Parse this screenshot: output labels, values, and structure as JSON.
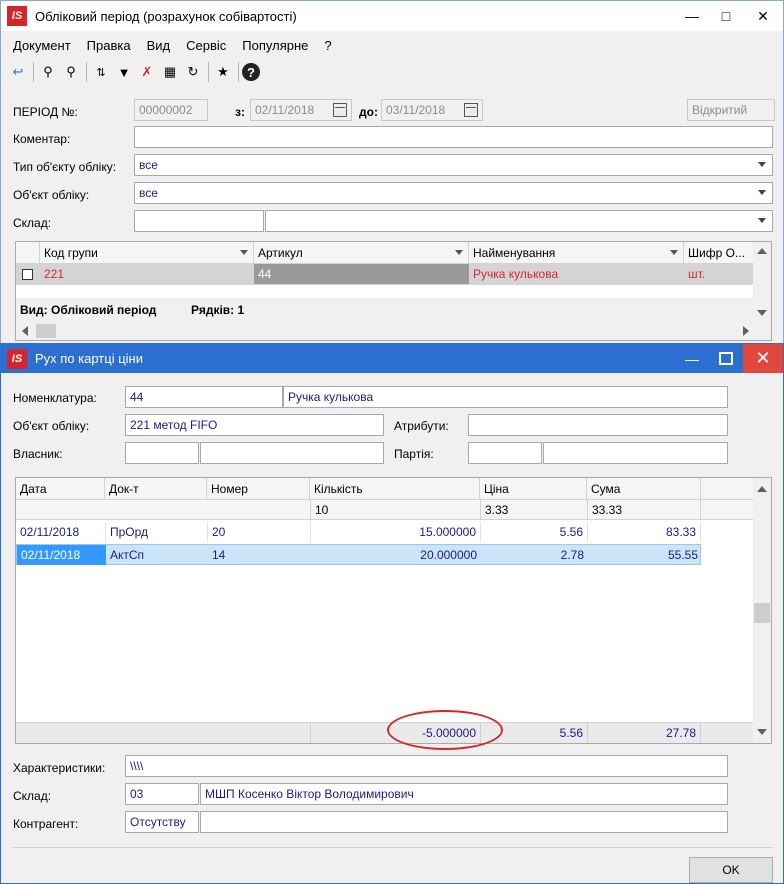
{
  "main_window": {
    "title": "Обліковий період (розрахунок собівартості)",
    "menu": [
      "Документ",
      "Правка",
      "Вид",
      "Сервіс",
      "Популярне",
      "?"
    ],
    "period_label": "ПЕРІОД №:",
    "period_value": "00000002",
    "from_label": "з:",
    "from_value": "02/11/2018",
    "to_label": "до:",
    "to_value": "03/11/2018",
    "status_value": "Відкритий",
    "comment_label": "Коментар:",
    "comment_value": "",
    "object_type_label": "Тип об'єкту обліку:",
    "object_type_value": "все",
    "object_label": "Об'єкт обліку:",
    "object_value": "все",
    "warehouse_label": "Склад:",
    "grid": {
      "columns": [
        "Код групи",
        "Артикул",
        "Найменування",
        "Шифр О..."
      ],
      "row": {
        "group_code": "221",
        "article": "44",
        "name": "Ручка кулькова",
        "unit": "шт."
      },
      "footer_view": "Вид: Обліковий період",
      "footer_rows": "Рядків: 1"
    }
  },
  "dialog": {
    "title": "Рух по картці ціни",
    "nomenclature_label": "Номенклатура:",
    "nomenclature_code": "44",
    "nomenclature_name": "Ручка кулькова",
    "object_label": "Об'єкт обліку:",
    "object_value": "221 метод FIFO",
    "attributes_label": "Атрибути:",
    "owner_label": "Власник:",
    "batch_label": "Партія:",
    "table": {
      "columns": [
        "Дата",
        "Док-т",
        "Номер",
        "Кількість",
        "Ціна",
        "Сума"
      ],
      "opening": {
        "qty": "10",
        "price": "3.33",
        "sum": "33.33"
      },
      "rows": [
        {
          "date": "02/11/2018",
          "doc": "ПрОрд",
          "num": "20",
          "qty": "15.000000",
          "price": "5.56",
          "sum": "83.33"
        },
        {
          "date": "02/11/2018",
          "doc": "АктСп",
          "num": "14",
          "qty": "20.000000",
          "price": "2.78",
          "sum": "55.55"
        }
      ],
      "totals": {
        "qty": "-5.000000",
        "price": "5.56",
        "sum": "27.78"
      }
    },
    "characteristics_label": "Характеристики:",
    "characteristics_value": "\\\\\\\\",
    "warehouse_label": "Склад:",
    "warehouse_code": "03",
    "warehouse_name": "МШП Косенко Віктор Володимирович",
    "contractor_label": "Контрагент:",
    "contractor_value": "Отсутству",
    "ok_label": "OK"
  },
  "colors": {
    "accent_red": "#d7262b",
    "title_blue": "#2b6fd1",
    "selected_row": "#cce4f7",
    "text_blue": "#1a1a8a"
  }
}
